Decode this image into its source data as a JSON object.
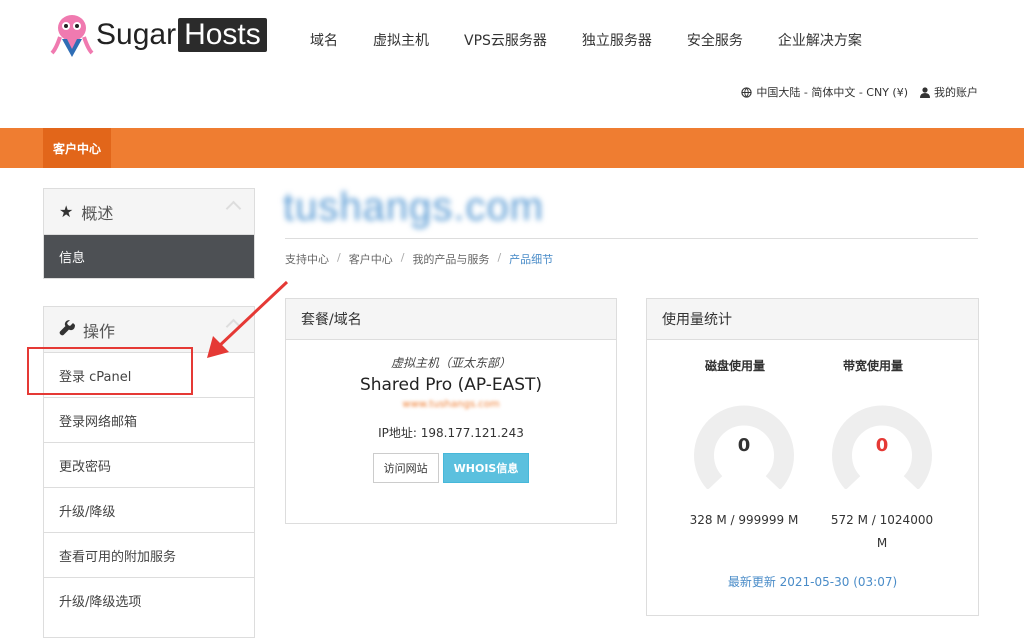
{
  "brand": {
    "name_part1": "Sugar",
    "name_part2": "Hosts"
  },
  "nav": {
    "items": [
      "域名",
      "虚拟主机",
      "VPS云服务器",
      "独立服务器",
      "安全服务",
      "企业解决方案"
    ]
  },
  "topbar": {
    "region": "中国大陆 - 简体中文 - CNY (¥)",
    "account": "我的账户"
  },
  "orange_bar": {
    "tab": "客户中心"
  },
  "sidebar": {
    "overview": {
      "title": "概述",
      "item": "信息"
    },
    "actions": {
      "title": "操作",
      "items": [
        "登录 cPanel",
        "登录网络邮箱",
        "更改密码",
        "升级/降级",
        "查看可用的附加服务",
        "升级/降级选项"
      ]
    }
  },
  "main": {
    "domain_title": "tushangs.com",
    "breadcrumb": [
      "支持中心",
      "客户中心",
      "我的产品与服务",
      "产品细节"
    ]
  },
  "package": {
    "header": "套餐/域名",
    "group": "虚拟主机（亚太东部）",
    "plan": "Shared Pro (AP-EAST)",
    "domain": "www.tushangs.com",
    "ip": "IP地址: 198.177.121.243",
    "visit_button": "访问网站",
    "whois_button": "WHOIS信息"
  },
  "usage": {
    "header": "使用量统计",
    "disk_label": "磁盘使用量",
    "bandwidth_label": "带宽使用量",
    "disk_value": "0",
    "bandwidth_value": "0",
    "disk_detail": "328 M / 999999 M",
    "bandwidth_detail_line1": "572 M / 1024000",
    "bandwidth_detail_line2": "M",
    "last_update": "最新更新 2021-05-30 (03:07)",
    "disk_percent": 0,
    "bandwidth_percent": 0
  },
  "colors": {
    "accent_orange": "#ef7d31",
    "accent_orange_dark": "#e2661a",
    "highlight_red": "#e53935",
    "link_blue": "#4a8cc8",
    "whois_blue": "#5bc0de"
  }
}
